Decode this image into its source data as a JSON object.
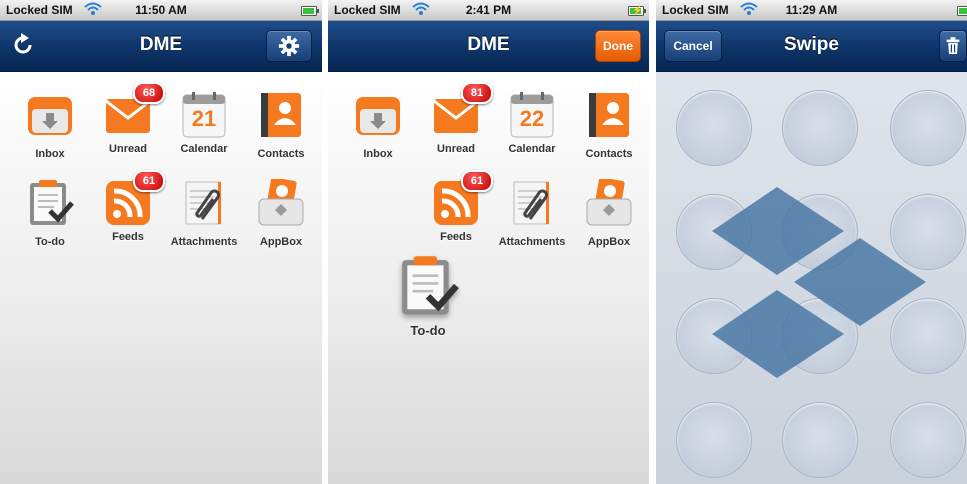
{
  "screens": [
    {
      "status": {
        "carrier": "Locked SIM",
        "time": "11:50 AM"
      },
      "nav": {
        "title": "DME"
      },
      "apps": [
        {
          "label": "Inbox",
          "icon": "inbox-icon"
        },
        {
          "label": "Unread",
          "icon": "envelope-icon",
          "badge": "68"
        },
        {
          "label": "Calendar",
          "icon": "calendar-icon",
          "day": "21"
        },
        {
          "label": "Contacts",
          "icon": "contacts-icon"
        },
        {
          "label": "To-do",
          "icon": "todo-clipboard-icon"
        },
        {
          "label": "Feeds",
          "icon": "rss-icon",
          "badge": "61"
        },
        {
          "label": "Attachments",
          "icon": "paperclip-document-icon"
        },
        {
          "label": "AppBox",
          "icon": "appbox-icon"
        }
      ]
    },
    {
      "status": {
        "carrier": "Locked SIM",
        "time": "2:41 PM"
      },
      "nav": {
        "title": "DME",
        "done_label": "Done"
      },
      "apps": [
        {
          "label": "Inbox",
          "icon": "inbox-icon"
        },
        {
          "label": "Unread",
          "icon": "envelope-icon",
          "badge": "81"
        },
        {
          "label": "Calendar",
          "icon": "calendar-icon",
          "day": "22"
        },
        {
          "label": "Contacts",
          "icon": "contacts-icon"
        },
        {
          "label": "Feeds",
          "icon": "rss-icon",
          "badge": "61"
        },
        {
          "label": "Attachments",
          "icon": "paperclip-document-icon"
        },
        {
          "label": "AppBox",
          "icon": "appbox-icon"
        },
        {
          "label": "To-do",
          "icon": "todo-clipboard-icon"
        }
      ]
    },
    {
      "status": {
        "carrier": "Locked SIM",
        "time": "11:29 AM"
      },
      "nav": {
        "title": "Swipe",
        "cancel_label": "Cancel"
      },
      "grid": {
        "rows": 4,
        "columns": 3
      }
    }
  ],
  "colors": {
    "nav_blue": "#0f3569",
    "accent_orange": "#f57a1f",
    "badge_red": "#d01010",
    "swipe_blue": "#3f6f9f"
  }
}
